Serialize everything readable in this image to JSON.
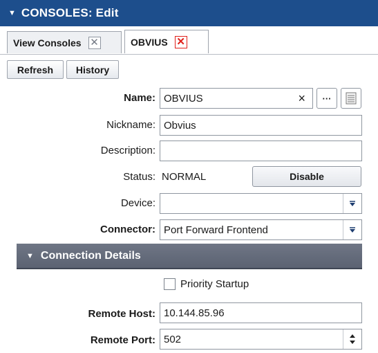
{
  "window": {
    "title": "CONSOLES: Edit"
  },
  "tabs": [
    {
      "label": "View Consoles"
    },
    {
      "label": "OBVIUS"
    }
  ],
  "toolbar": {
    "refresh_label": "Refresh",
    "history_label": "History"
  },
  "form": {
    "name": {
      "label": "Name:",
      "value": "OBVIUS",
      "clear_glyph": "×",
      "more_glyph": "···"
    },
    "nickname": {
      "label": "Nickname:",
      "value": "Obvius"
    },
    "description": {
      "label": "Description:",
      "value": ""
    },
    "status": {
      "label": "Status:",
      "value": "NORMAL",
      "button_label": "Disable"
    },
    "device": {
      "label": "Device:",
      "value": ""
    },
    "connector": {
      "label": "Connector:",
      "value": "Port Forward Frontend"
    }
  },
  "connection_details": {
    "title": "Connection Details",
    "priority_startup_label": "Priority Startup",
    "priority_startup_checked": false,
    "remote_host": {
      "label": "Remote Host:",
      "value": "10.144.85.96"
    },
    "remote_port": {
      "label": "Remote Port:",
      "value": "502"
    }
  },
  "icons": {
    "collapse": "caret-down-icon",
    "close": "close-icon",
    "dropdown": "dropdown-arrow-icon",
    "spin": "spinner-icon",
    "notes": "notes-icon"
  },
  "colors": {
    "titlebar": "#1d4e8c",
    "section_header": "#5f6676",
    "close_red": "#e0201a"
  }
}
